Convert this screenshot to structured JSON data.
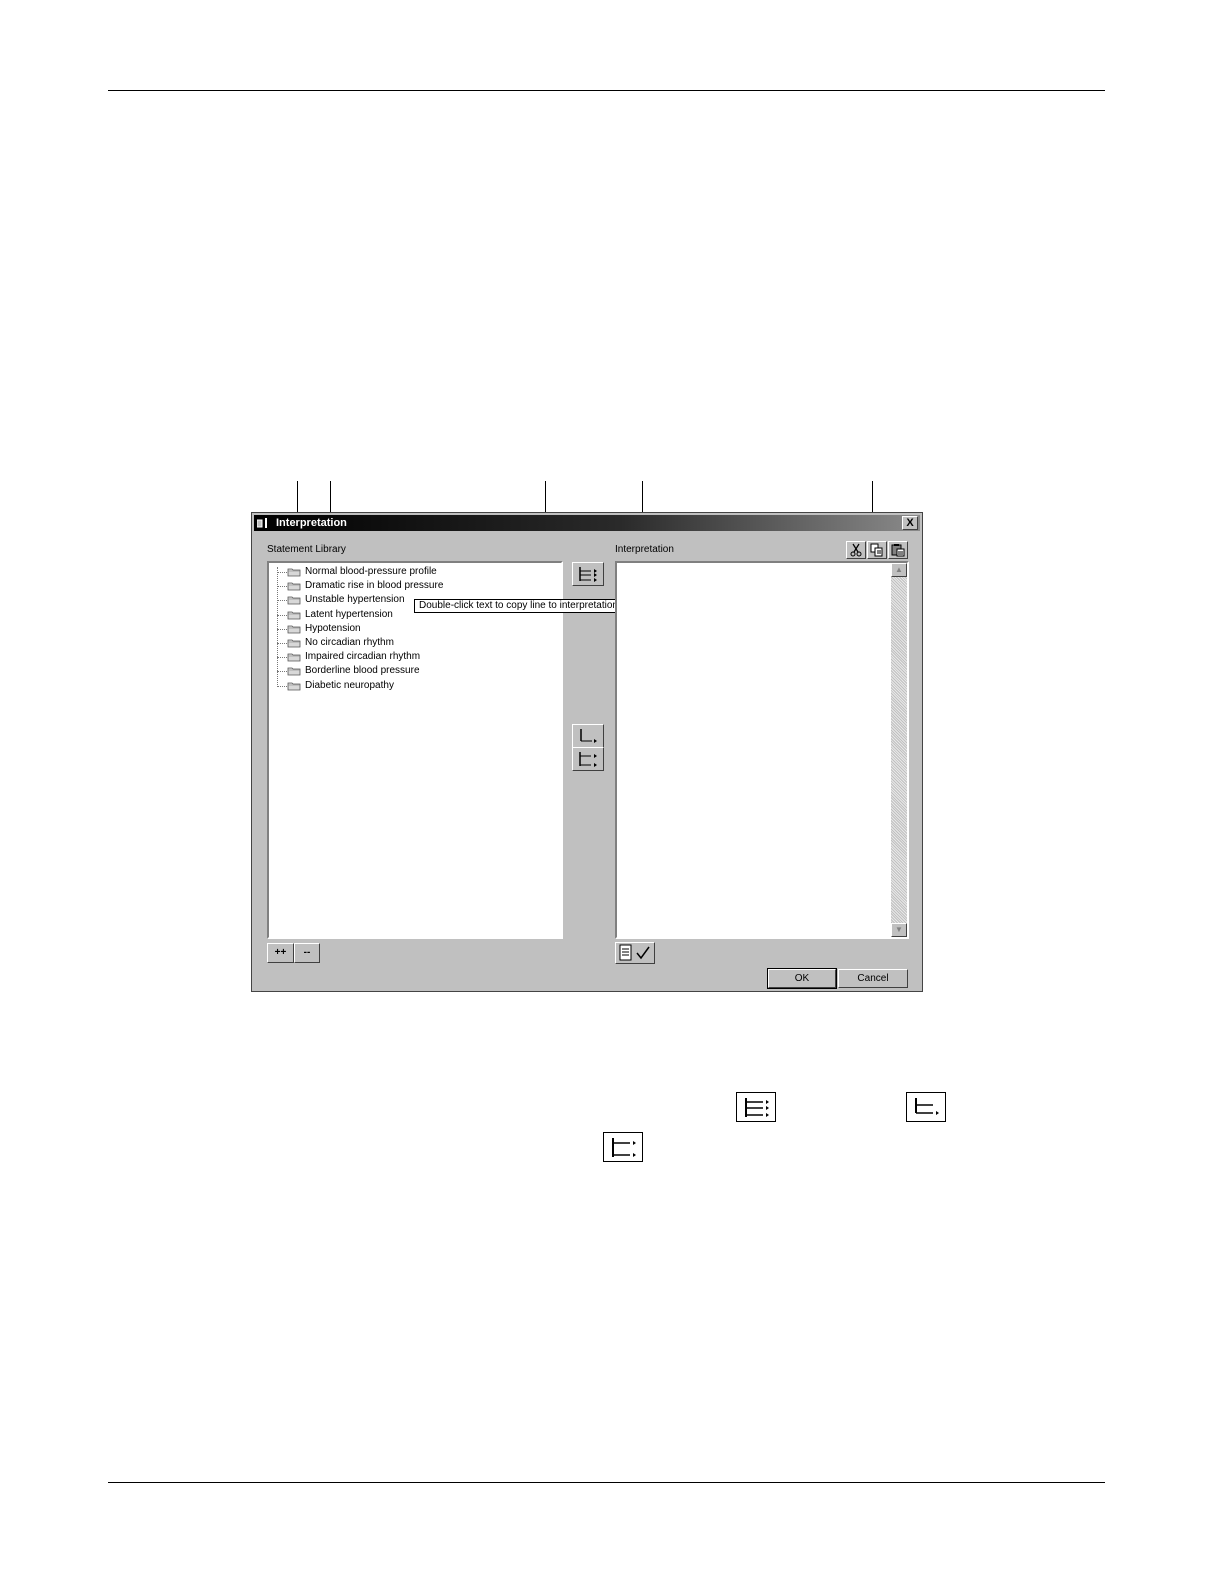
{
  "dialog": {
    "title": "Interpretation",
    "close_label": "X",
    "library_label": "Statement Library",
    "interpretation_label": "Interpretation",
    "tooltip": "Double-click text to copy line to interpretation field.",
    "tree_items": [
      {
        "label": "Normal blood-pressure profile"
      },
      {
        "label": "Dramatic rise in blood pressure"
      },
      {
        "label": "Unstable hypertension"
      },
      {
        "label": "Latent hypertension"
      },
      {
        "label": "Hypotension"
      },
      {
        "label": "No circadian rhythm"
      },
      {
        "label": "Impaired circadian rhythm"
      },
      {
        "label": "Borderline blood pressure"
      },
      {
        "label": "Diabetic neuropathy"
      }
    ],
    "expand_label": "++",
    "collapse_label": "--",
    "ok_label": "OK",
    "cancel_label": "Cancel",
    "toolbar_icons": [
      "cut-icon",
      "copy-icon",
      "paste-icon"
    ]
  }
}
